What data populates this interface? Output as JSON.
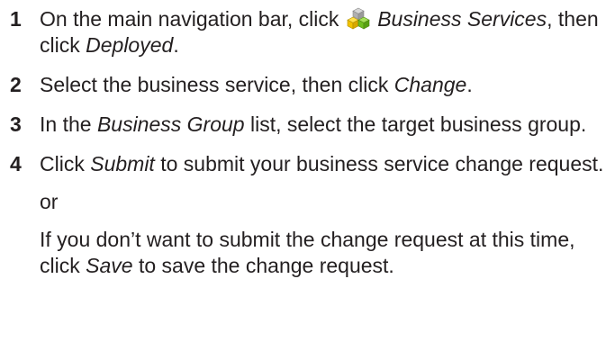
{
  "steps": [
    {
      "number": "1",
      "t1": "On the main navigation bar, click ",
      "icon": "business-services-cubes-icon",
      "t2": " ",
      "i1": "Business Services",
      "t3": ", then click ",
      "i2": "Deployed",
      "t4": "."
    },
    {
      "number": "2",
      "t1": "Select the business service, then click ",
      "i1": "Change",
      "t2": "."
    },
    {
      "number": "3",
      "t1": "In the ",
      "i1": "Business Group",
      "t2": " list, select the target business group."
    },
    {
      "number": "4",
      "t1": "Click ",
      "i1": "Submit",
      "t2": " to submit your business service change request."
    }
  ],
  "or_text": "or",
  "alternative": {
    "t1": "If you don’t want to submit the change request at this time, click ",
    "i1": "Save",
    "t2": " to save the change request."
  },
  "colors": {
    "text": "#231f20",
    "cube_yellow": "#f2c200",
    "cube_green": "#6fbf1e",
    "cube_gray": "#b8b8b8"
  }
}
